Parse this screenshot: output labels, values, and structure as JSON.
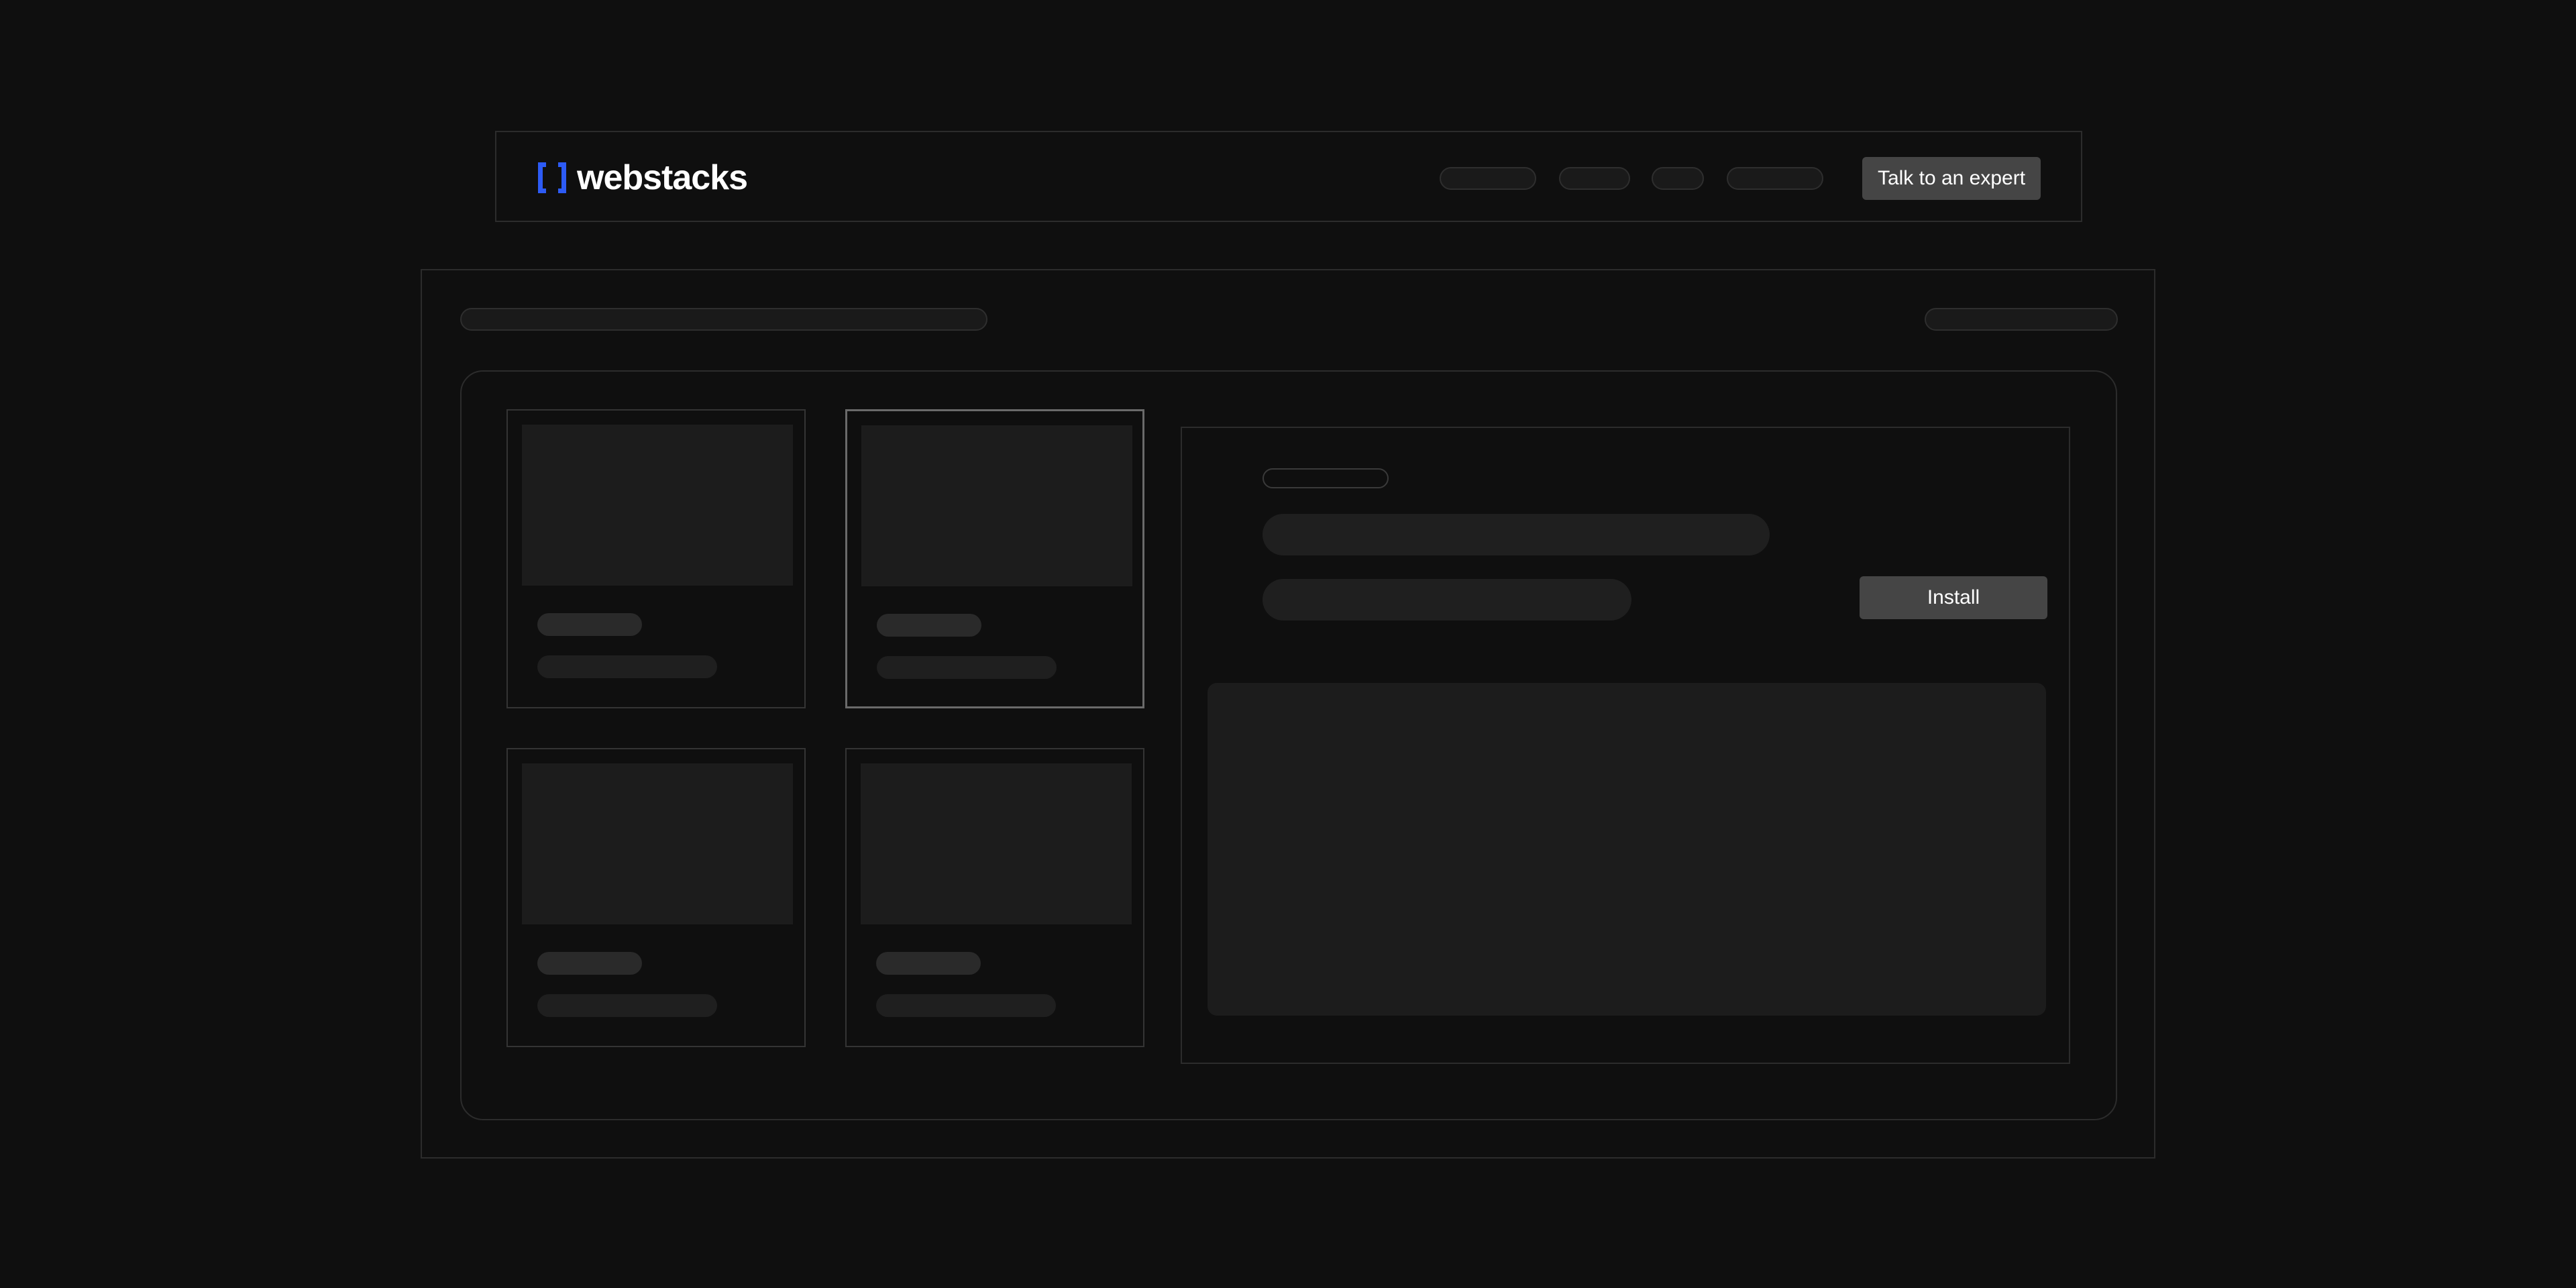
{
  "navbar": {
    "logo_text": "webstacks",
    "logo_icon": "bracket-logo-icon",
    "cta_label": "Talk to an expert"
  },
  "detail": {
    "install_label": "Install"
  },
  "colors": {
    "background": "#0f0f0f",
    "brand_blue": "#2d5bf5",
    "button": "#454545",
    "border": "#2c2c2c",
    "placeholder": "#1c1c1c"
  }
}
